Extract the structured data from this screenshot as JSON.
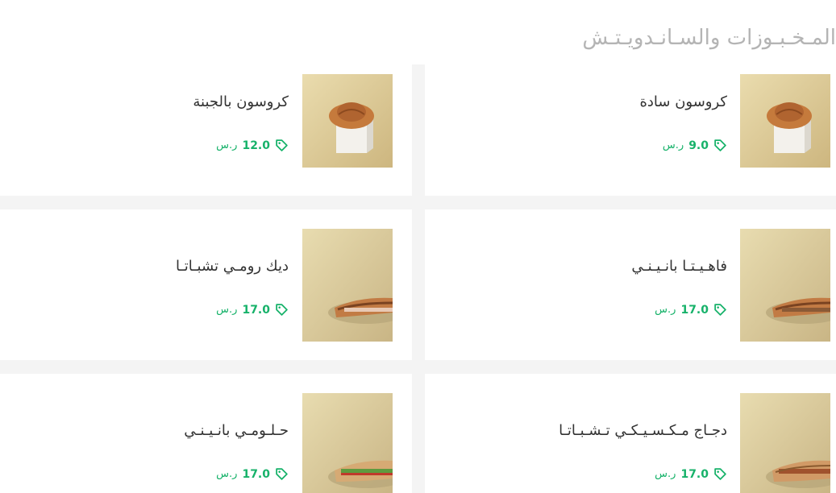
{
  "section": {
    "title": "المـخـبـوزات والسـانـدويـتـش"
  },
  "items": [
    {
      "name": "كروسون سادة",
      "price": "9.0",
      "currency": "ر.س",
      "image": "croissant"
    },
    {
      "name": "كروسون بالجبنة",
      "price": "12.0",
      "currency": "ر.س",
      "image": "croissant"
    },
    {
      "name": "فاهـيـتـا بانـيـنـي",
      "price": "17.0",
      "currency": "ر.س",
      "image": "panini"
    },
    {
      "name": "ديك رومـي تشبـاتـا",
      "price": "17.0",
      "currency": "ر.س",
      "image": "panini"
    },
    {
      "name": "دجـاج مـكـسـيـكـي تـشـبـاتـا",
      "price": "17.0",
      "currency": "ر.س",
      "image": "panini"
    },
    {
      "name": "حـلـومـي بانـيـنـي",
      "price": "17.0",
      "currency": "ر.س",
      "image": "panini"
    }
  ],
  "colors": {
    "accent": "#17b26a",
    "title": "#b4b4b4",
    "text": "#333333",
    "background": "#f4f4f4"
  },
  "icons": {
    "price": "tag-icon"
  }
}
